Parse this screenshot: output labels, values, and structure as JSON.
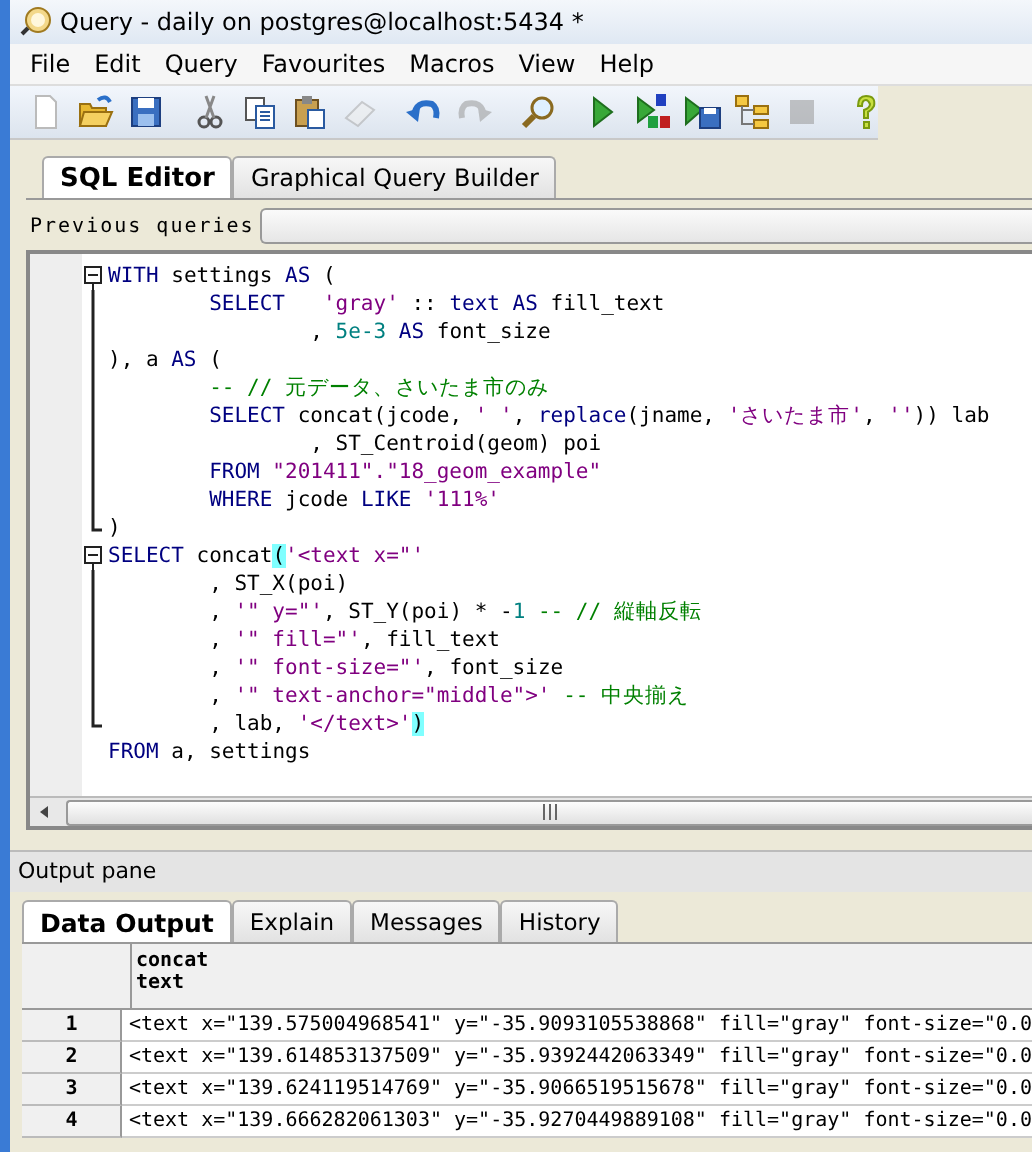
{
  "window": {
    "title": "Query - daily on postgres@localhost:5434 *"
  },
  "menu": [
    "File",
    "Edit",
    "Query",
    "Favourites",
    "Macros",
    "View",
    "Help"
  ],
  "toolbar": [
    {
      "kind": "new",
      "disabled": false
    },
    {
      "kind": "open",
      "disabled": false
    },
    {
      "kind": "save",
      "disabled": false
    },
    {
      "kind": "sep"
    },
    {
      "kind": "cut",
      "disabled": false
    },
    {
      "kind": "copy",
      "disabled": false
    },
    {
      "kind": "paste",
      "disabled": false
    },
    {
      "kind": "eraser",
      "disabled": true
    },
    {
      "kind": "sep"
    },
    {
      "kind": "undo",
      "disabled": false
    },
    {
      "kind": "redo",
      "disabled": true
    },
    {
      "kind": "sep"
    },
    {
      "kind": "find",
      "disabled": false
    },
    {
      "kind": "sep"
    },
    {
      "kind": "run",
      "disabled": false
    },
    {
      "kind": "run-pgs",
      "disabled": false
    },
    {
      "kind": "run-save",
      "disabled": false
    },
    {
      "kind": "explain",
      "disabled": false
    },
    {
      "kind": "stop",
      "disabled": true
    },
    {
      "kind": "sep"
    },
    {
      "kind": "help",
      "disabled": false
    }
  ],
  "editor_tabs": [
    {
      "label": "SQL Editor",
      "selected": true
    },
    {
      "label": "Graphical Query Builder",
      "selected": false
    }
  ],
  "previous_queries": {
    "label": "Previous queries"
  },
  "code": [
    {
      "kind": "fold-start",
      "tokens": [
        {
          "kind": "keyword",
          "text": "WITH"
        },
        {
          "kind": "plain",
          "text": " settings "
        },
        {
          "kind": "keyword",
          "text": "AS"
        },
        {
          "kind": "plain",
          "text": " ("
        }
      ]
    },
    {
      "kind": "fold-middle",
      "tokens": [
        {
          "kind": "keyword",
          "text": "        SELECT   "
        },
        {
          "kind": "string",
          "text": "'gray'"
        },
        {
          "kind": "plain",
          "text": " :: "
        },
        {
          "kind": "keyword",
          "text": "text AS"
        },
        {
          "kind": "plain",
          "text": " fill_text"
        }
      ]
    },
    {
      "kind": "fold-middle",
      "tokens": [
        {
          "kind": "plain",
          "text": "                , "
        },
        {
          "kind": "number",
          "text": "5e-3"
        },
        {
          "kind": "keyword",
          "text": " AS"
        },
        {
          "kind": "plain",
          "text": " font_size"
        }
      ]
    },
    {
      "kind": "fold-middle",
      "tokens": [
        {
          "kind": "plain",
          "text": "), a "
        },
        {
          "kind": "keyword",
          "text": "AS"
        },
        {
          "kind": "plain",
          "text": " ("
        }
      ]
    },
    {
      "kind": "fold-middle",
      "tokens": [
        {
          "kind": "comment",
          "text": "        -- // 元データ、さいたま市のみ"
        }
      ]
    },
    {
      "kind": "fold-middle",
      "tokens": [
        {
          "kind": "keyword",
          "text": "        SELECT"
        },
        {
          "kind": "plain",
          "text": " concat(jcode, "
        },
        {
          "kind": "string",
          "text": "' '"
        },
        {
          "kind": "plain",
          "text": ", "
        },
        {
          "kind": "keyword",
          "text": "replace"
        },
        {
          "kind": "plain",
          "text": "(jname, "
        },
        {
          "kind": "string",
          "text": "'さいたま市'"
        },
        {
          "kind": "plain",
          "text": ", "
        },
        {
          "kind": "string",
          "text": "''"
        },
        {
          "kind": "plain",
          "text": ")) lab"
        }
      ]
    },
    {
      "kind": "fold-middle",
      "tokens": [
        {
          "kind": "plain",
          "text": "                , ST_Centroid(geom) poi"
        }
      ]
    },
    {
      "kind": "fold-middle",
      "tokens": [
        {
          "kind": "keyword",
          "text": "        FROM"
        },
        {
          "kind": "string",
          "text": " \"201411\".\"18_geom_example\""
        }
      ]
    },
    {
      "kind": "fold-middle",
      "tokens": [
        {
          "kind": "keyword",
          "text": "        WHERE"
        },
        {
          "kind": "plain",
          "text": " jcode "
        },
        {
          "kind": "keyword",
          "text": "LIKE"
        },
        {
          "kind": "string",
          "text": " '111%'"
        }
      ]
    },
    {
      "kind": "fold-end",
      "tokens": [
        {
          "kind": "plain",
          "text": ")"
        }
      ]
    },
    {
      "kind": "fold-start",
      "tokens": [
        {
          "kind": "keyword",
          "text": "SELECT"
        },
        {
          "kind": "plain",
          "text": " concat"
        },
        {
          "kind": "brace-match",
          "text": "("
        },
        {
          "kind": "string",
          "text": "'<text x=\"'"
        }
      ]
    },
    {
      "kind": "fold-middle",
      "tokens": [
        {
          "kind": "plain",
          "text": "        , ST_X(poi)"
        }
      ]
    },
    {
      "kind": "fold-middle",
      "tokens": [
        {
          "kind": "plain",
          "text": "        , "
        },
        {
          "kind": "string",
          "text": "'\" y=\"'"
        },
        {
          "kind": "plain",
          "text": ", ST_Y(poi) * -"
        },
        {
          "kind": "number",
          "text": "1"
        },
        {
          "kind": "comment",
          "text": " -- // 縦軸反転"
        }
      ]
    },
    {
      "kind": "fold-middle",
      "tokens": [
        {
          "kind": "plain",
          "text": "        , "
        },
        {
          "kind": "string",
          "text": "'\" fill=\"'"
        },
        {
          "kind": "plain",
          "text": ", fill_text"
        }
      ]
    },
    {
      "kind": "fold-middle",
      "tokens": [
        {
          "kind": "plain",
          "text": "        , "
        },
        {
          "kind": "string",
          "text": "'\" font-size=\"'"
        },
        {
          "kind": "plain",
          "text": ", font_size"
        }
      ]
    },
    {
      "kind": "fold-middle",
      "tokens": [
        {
          "kind": "plain",
          "text": "        , "
        },
        {
          "kind": "string",
          "text": "'\" text-anchor=\"middle\">'"
        },
        {
          "kind": "comment",
          "text": " -- 中央揃え"
        }
      ]
    },
    {
      "kind": "fold-end",
      "tokens": [
        {
          "kind": "plain",
          "text": "        , lab, "
        },
        {
          "kind": "string",
          "text": "'</text>'"
        },
        {
          "kind": "brace-match",
          "text": ")"
        }
      ]
    },
    {
      "kind": "plain",
      "tokens": [
        {
          "kind": "keyword",
          "text": "FROM"
        },
        {
          "kind": "plain",
          "text": " a, settings"
        }
      ]
    }
  ],
  "output_pane": {
    "title": "Output pane",
    "tabs": [
      {
        "label": "Data Output",
        "selected": true
      },
      {
        "label": "Explain",
        "selected": false
      },
      {
        "label": "Messages",
        "selected": false
      },
      {
        "label": "History",
        "selected": false
      }
    ],
    "columns": [
      {
        "name": "concat",
        "type": "text"
      }
    ],
    "rows": [
      {
        "number": "1",
        "cell": "<text x=\"139.575004968541\" y=\"-35.9093105538868\" fill=\"gray\" font-size=\"0.0"
      },
      {
        "number": "2",
        "cell": "<text x=\"139.614853137509\" y=\"-35.9392442063349\" fill=\"gray\" font-size=\"0.0"
      },
      {
        "number": "3",
        "cell": "<text x=\"139.624119514769\" y=\"-35.9066519515678\" fill=\"gray\" font-size=\"0.0"
      },
      {
        "number": "4",
        "cell": "<text x=\"139.666282061303\" y=\"-35.9270449889108\" fill=\"gray\" font-size=\"0.0"
      }
    ]
  }
}
